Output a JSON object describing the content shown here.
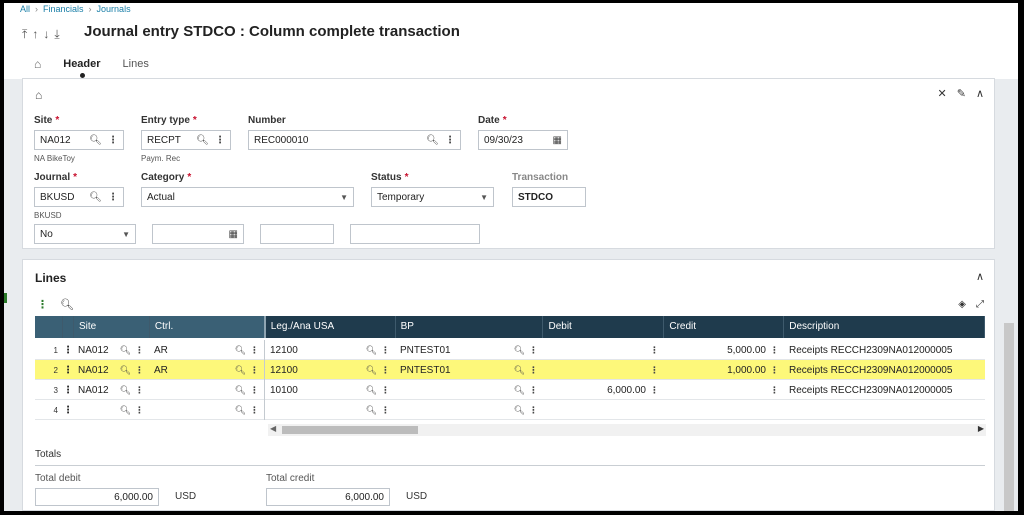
{
  "breadcrumb": [
    "All",
    "Financials",
    "Journals"
  ],
  "title": "Journal entry STDCO : Column complete transaction",
  "tabs": {
    "header": "Header",
    "lines": "Lines"
  },
  "header": {
    "site": {
      "label": "Site",
      "value": "NA012",
      "sub": "NA BikeToy"
    },
    "entry_type": {
      "label": "Entry type",
      "value": "RECPT",
      "sub": "Paym. Rec"
    },
    "number": {
      "label": "Number",
      "value": "REC000010"
    },
    "date": {
      "label": "Date",
      "value": "09/30/23"
    },
    "journal": {
      "label": "Journal",
      "value": "BKUSD",
      "sub": "BKUSD"
    },
    "category": {
      "label": "Category",
      "value": "Actual"
    },
    "status": {
      "label": "Status",
      "value": "Temporary"
    },
    "transaction": {
      "label": "Transaction",
      "value": "STDCO"
    },
    "partial": {
      "value": "No"
    }
  },
  "lines": {
    "title": "Lines",
    "columns": [
      "Site",
      "Ctrl.",
      "Leg./Ana USA",
      "BP",
      "Debit",
      "Credit",
      "Description"
    ],
    "rows": [
      {
        "n": "1",
        "site": "NA012",
        "ctrl": "AR",
        "account": "12100",
        "bp": "PNTEST01",
        "debit": "",
        "credit": "5,000.00",
        "desc": "Receipts RECCH2309NA012000005"
      },
      {
        "n": "2",
        "site": "NA012",
        "ctrl": "AR",
        "account": "12100",
        "bp": "PNTEST01",
        "debit": "",
        "credit": "1,000.00",
        "desc": "Receipts RECCH2309NA012000005"
      },
      {
        "n": "3",
        "site": "NA012",
        "ctrl": "",
        "account": "10100",
        "bp": "",
        "debit": "6,000.00",
        "credit": "",
        "desc": "Receipts RECCH2309NA012000005"
      },
      {
        "n": "4",
        "site": "",
        "ctrl": "",
        "account": "",
        "bp": "",
        "debit": "",
        "credit": "",
        "desc": ""
      }
    ],
    "highlight_color": "#fdf87a"
  },
  "totals": {
    "title": "Totals",
    "debit_label": "Total debit",
    "debit_value": "6,000.00",
    "credit_label": "Total credit",
    "credit_value": "6,000.00",
    "currency": "USD"
  }
}
